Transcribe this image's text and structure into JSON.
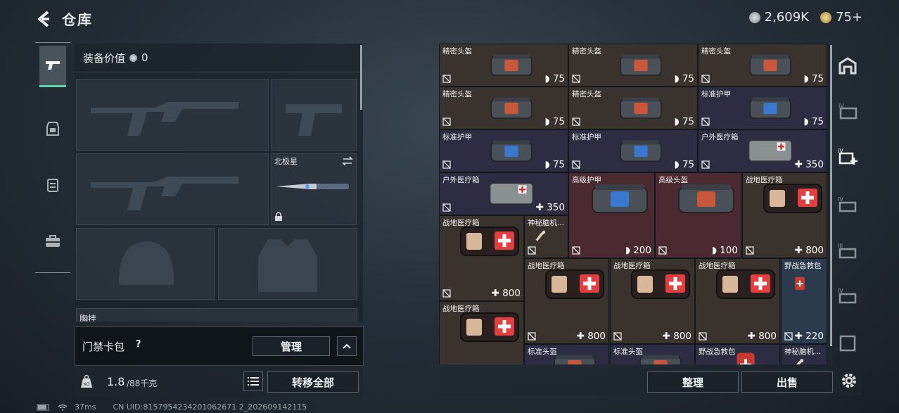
{
  "header": {
    "title": "仓库"
  },
  "currency": {
    "silver": "2,609K",
    "gold": "75+"
  },
  "tabs": [
    {
      "icon": "gun-icon",
      "active": true
    },
    {
      "icon": "armor-icon",
      "active": false
    },
    {
      "icon": "chest-rig-icon",
      "active": false
    },
    {
      "icon": "briefcase-icon",
      "active": false
    }
  ],
  "equip": {
    "value_label": "装备价值",
    "value": "0",
    "sidearm_melee_label": "北极星",
    "chest_label": "胸挂"
  },
  "keycard": {
    "label": "门禁卡包",
    "help": "?",
    "manage_label": "管理"
  },
  "weight": {
    "current": "1.8",
    "max": "/88千克",
    "transfer_all_label": "转移全部"
  },
  "storage": {
    "items": [
      {
        "name": "精密头盔",
        "value": "75",
        "kind": "shield",
        "color": "brown"
      },
      {
        "name": "精密头盔",
        "value": "75",
        "kind": "shield",
        "color": "brown"
      },
      {
        "name": "精密头盔",
        "value": "75",
        "kind": "shield",
        "color": "brown"
      },
      {
        "name": "精密头盔",
        "value": "75",
        "kind": "shield",
        "color": "brown"
      },
      {
        "name": "精密头盔",
        "value": "75",
        "kind": "shield",
        "color": "brown"
      },
      {
        "name": "标准护甲",
        "value": "75",
        "kind": "shield",
        "color": "purple"
      },
      {
        "name": "标准护甲",
        "value": "75",
        "kind": "shield",
        "color": "purple"
      },
      {
        "name": "标准护甲",
        "value": "75",
        "kind": "shield",
        "color": "purple"
      },
      {
        "name": "户外医疗箱",
        "value": "350",
        "kind": "plus",
        "color": "purple"
      },
      {
        "name": "户外医疗箱",
        "value": "350",
        "kind": "plus",
        "color": "purple"
      },
      {
        "name": "高级护甲",
        "value": "200",
        "kind": "shield",
        "color": "red"
      },
      {
        "name": "高级头盔",
        "value": "100",
        "kind": "shield",
        "color": "red"
      },
      {
        "name": "战地医疗箱",
        "value": "800",
        "kind": "plus",
        "color": "brown"
      },
      {
        "name": "战地医疗箱",
        "value": "800",
        "kind": "plus",
        "color": "brown"
      },
      {
        "name": "神秘脑机...",
        "value": "",
        "kind": "none",
        "color": "brown"
      },
      {
        "name": "战地医疗箱",
        "value": "800",
        "kind": "plus",
        "color": "brown"
      },
      {
        "name": "战地医疗箱",
        "value": "800",
        "kind": "plus",
        "color": "brown"
      },
      {
        "name": "战地医疗箱",
        "value": "800",
        "kind": "plus",
        "color": "brown"
      },
      {
        "name": "野战急救包",
        "value": "220",
        "kind": "plus",
        "color": "blue"
      },
      {
        "name": "战地医疗箱",
        "value": "",
        "kind": "none",
        "color": "brown"
      },
      {
        "name": "标准头盔",
        "value": "",
        "kind": "none",
        "color": "purple"
      },
      {
        "name": "标准头盔",
        "value": "",
        "kind": "none",
        "color": "purple"
      },
      {
        "name": "野战急救包",
        "value": "",
        "kind": "none",
        "color": "purple"
      },
      {
        "name": "神秘脑机...",
        "value": "",
        "kind": "none",
        "color": "purple"
      }
    ],
    "organize_label": "整理",
    "sell_label": "出售"
  },
  "status": {
    "ping": "37ms",
    "uid": "CN UID:8157954234201062671 2_202609142115"
  },
  "colors": {
    "accent": "#5fd6b0",
    "brown": "#3a322c",
    "purple": "#2d2c42",
    "red": "#4a2a30",
    "blue": "#2b3a4c"
  }
}
